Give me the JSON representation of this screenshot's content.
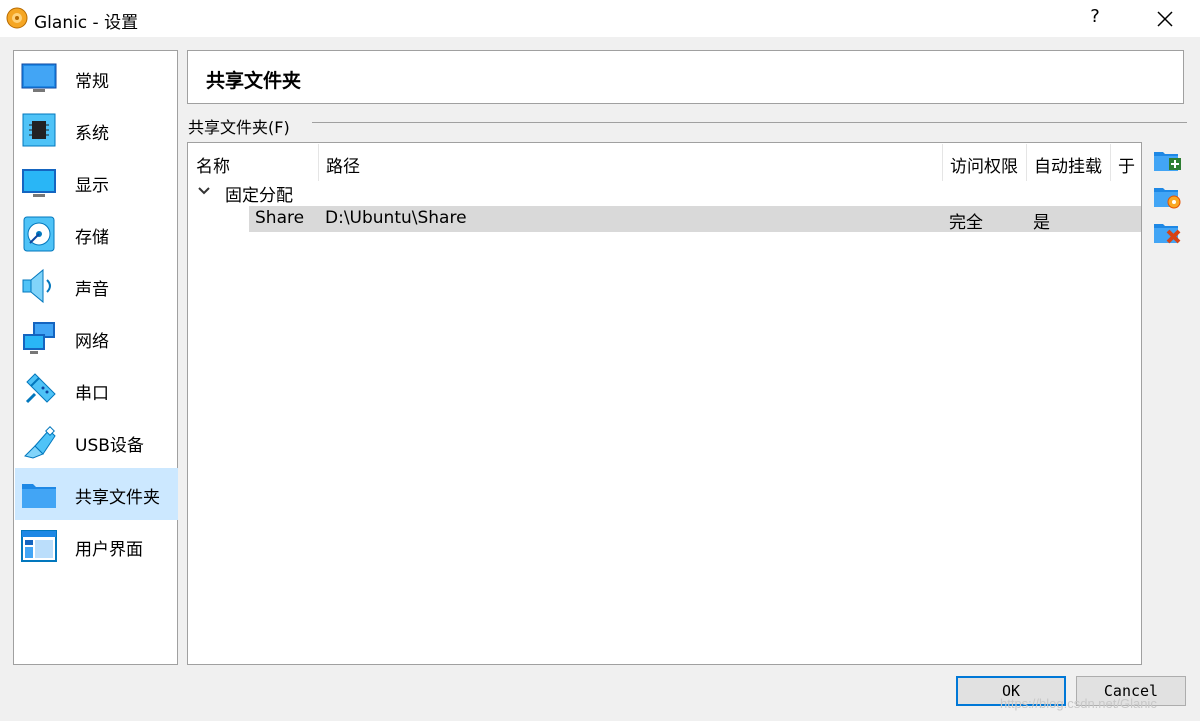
{
  "window": {
    "title": "Glanic - 设置",
    "help_label": "?",
    "app_icon": "virtualbox-icon"
  },
  "sidebar": {
    "items": [
      {
        "label": "常规",
        "icon": "monitor-icon"
      },
      {
        "label": "系统",
        "icon": "chip-icon"
      },
      {
        "label": "显示",
        "icon": "display-icon"
      },
      {
        "label": "存储",
        "icon": "disk-icon"
      },
      {
        "label": "声音",
        "icon": "speaker-icon"
      },
      {
        "label": "网络",
        "icon": "network-icon"
      },
      {
        "label": "串口",
        "icon": "serial-port-icon"
      },
      {
        "label": "USB设备",
        "icon": "usb-icon"
      },
      {
        "label": "共享文件夹",
        "icon": "folder-icon",
        "selected": true
      },
      {
        "label": "用户界面",
        "icon": "window-icon"
      }
    ]
  },
  "page": {
    "title": "共享文件夹",
    "group_label": "共享文件夹(F)",
    "columns": [
      "名称",
      "路径",
      "访问权限",
      "自动挂载",
      "于"
    ],
    "tree": {
      "group": "固定分配",
      "rows": [
        {
          "name": "Share",
          "path": "D:\\Ubuntu\\Share",
          "access": "完全",
          "automount": "是",
          "at": ""
        }
      ]
    }
  },
  "tools": [
    "add-share-icon",
    "edit-share-icon",
    "remove-share-icon"
  ],
  "buttons": {
    "ok": "OK",
    "cancel": "Cancel"
  },
  "watermark": "https://blog.csdn.net/Glanic",
  "colors": {
    "selection": "#cce8ff",
    "row_highlight": "#d9d9d9",
    "accent": "#0078d7"
  }
}
